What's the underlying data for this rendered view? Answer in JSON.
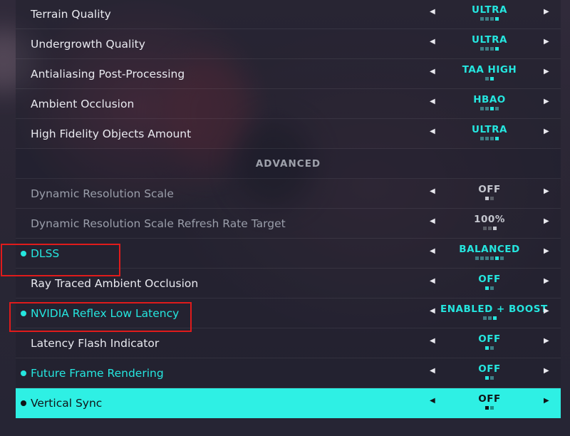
{
  "colors": {
    "accent": "#25e6df",
    "highlight_box": "#e01b1b",
    "selected_row": "#2ef0e4"
  },
  "icons": {
    "left_arrow": "triangle-left-icon",
    "right_arrow": "triangle-right-icon",
    "bullet": "dot-icon"
  },
  "settings": [
    {
      "label": "Terrain Quality",
      "value": "ULTRA",
      "level": 4,
      "levels": 4,
      "style": "normal",
      "dot": false
    },
    {
      "label": "Undergrowth Quality",
      "value": "ULTRA",
      "level": 4,
      "levels": 4,
      "style": "normal",
      "dot": false
    },
    {
      "label": "Antialiasing Post-Processing",
      "value": "TAA HIGH",
      "level": 2,
      "levels": 2,
      "style": "normal",
      "dot": false
    },
    {
      "label": "Ambient Occlusion",
      "value": "HBAO",
      "level": 3,
      "levels": 4,
      "style": "normal",
      "dot": false
    },
    {
      "label": "High Fidelity Objects Amount",
      "value": "ULTRA",
      "level": 4,
      "levels": 4,
      "style": "normal",
      "dot": false
    },
    {
      "section": "ADVANCED"
    },
    {
      "label": "Dynamic Resolution Scale",
      "value": "OFF",
      "level": 1,
      "levels": 2,
      "style": "dim",
      "dot": false
    },
    {
      "label": "Dynamic Resolution Scale Refresh Rate Target",
      "value": "100%",
      "level": 3,
      "levels": 3,
      "style": "dim",
      "dot": false
    },
    {
      "label": "DLSS",
      "value": "BALANCED",
      "level": 5,
      "levels": 6,
      "style": "teal",
      "dot": true
    },
    {
      "label": "Ray Traced Ambient Occlusion",
      "value": "OFF",
      "level": 1,
      "levels": 2,
      "style": "normal",
      "dot": false
    },
    {
      "label": "NVIDIA Reflex Low Latency",
      "value": "ENABLED + BOOST",
      "level": 3,
      "levels": 3,
      "style": "teal",
      "dot": true
    },
    {
      "label": "Latency Flash Indicator",
      "value": "OFF",
      "level": 1,
      "levels": 2,
      "style": "normal",
      "dot": false
    },
    {
      "label": "Future Frame Rendering",
      "value": "OFF",
      "level": 1,
      "levels": 2,
      "style": "teal",
      "dot": true
    },
    {
      "label": "Vertical Sync",
      "value": "OFF",
      "level": 1,
      "levels": 2,
      "style": "selected",
      "dot": true
    }
  ]
}
